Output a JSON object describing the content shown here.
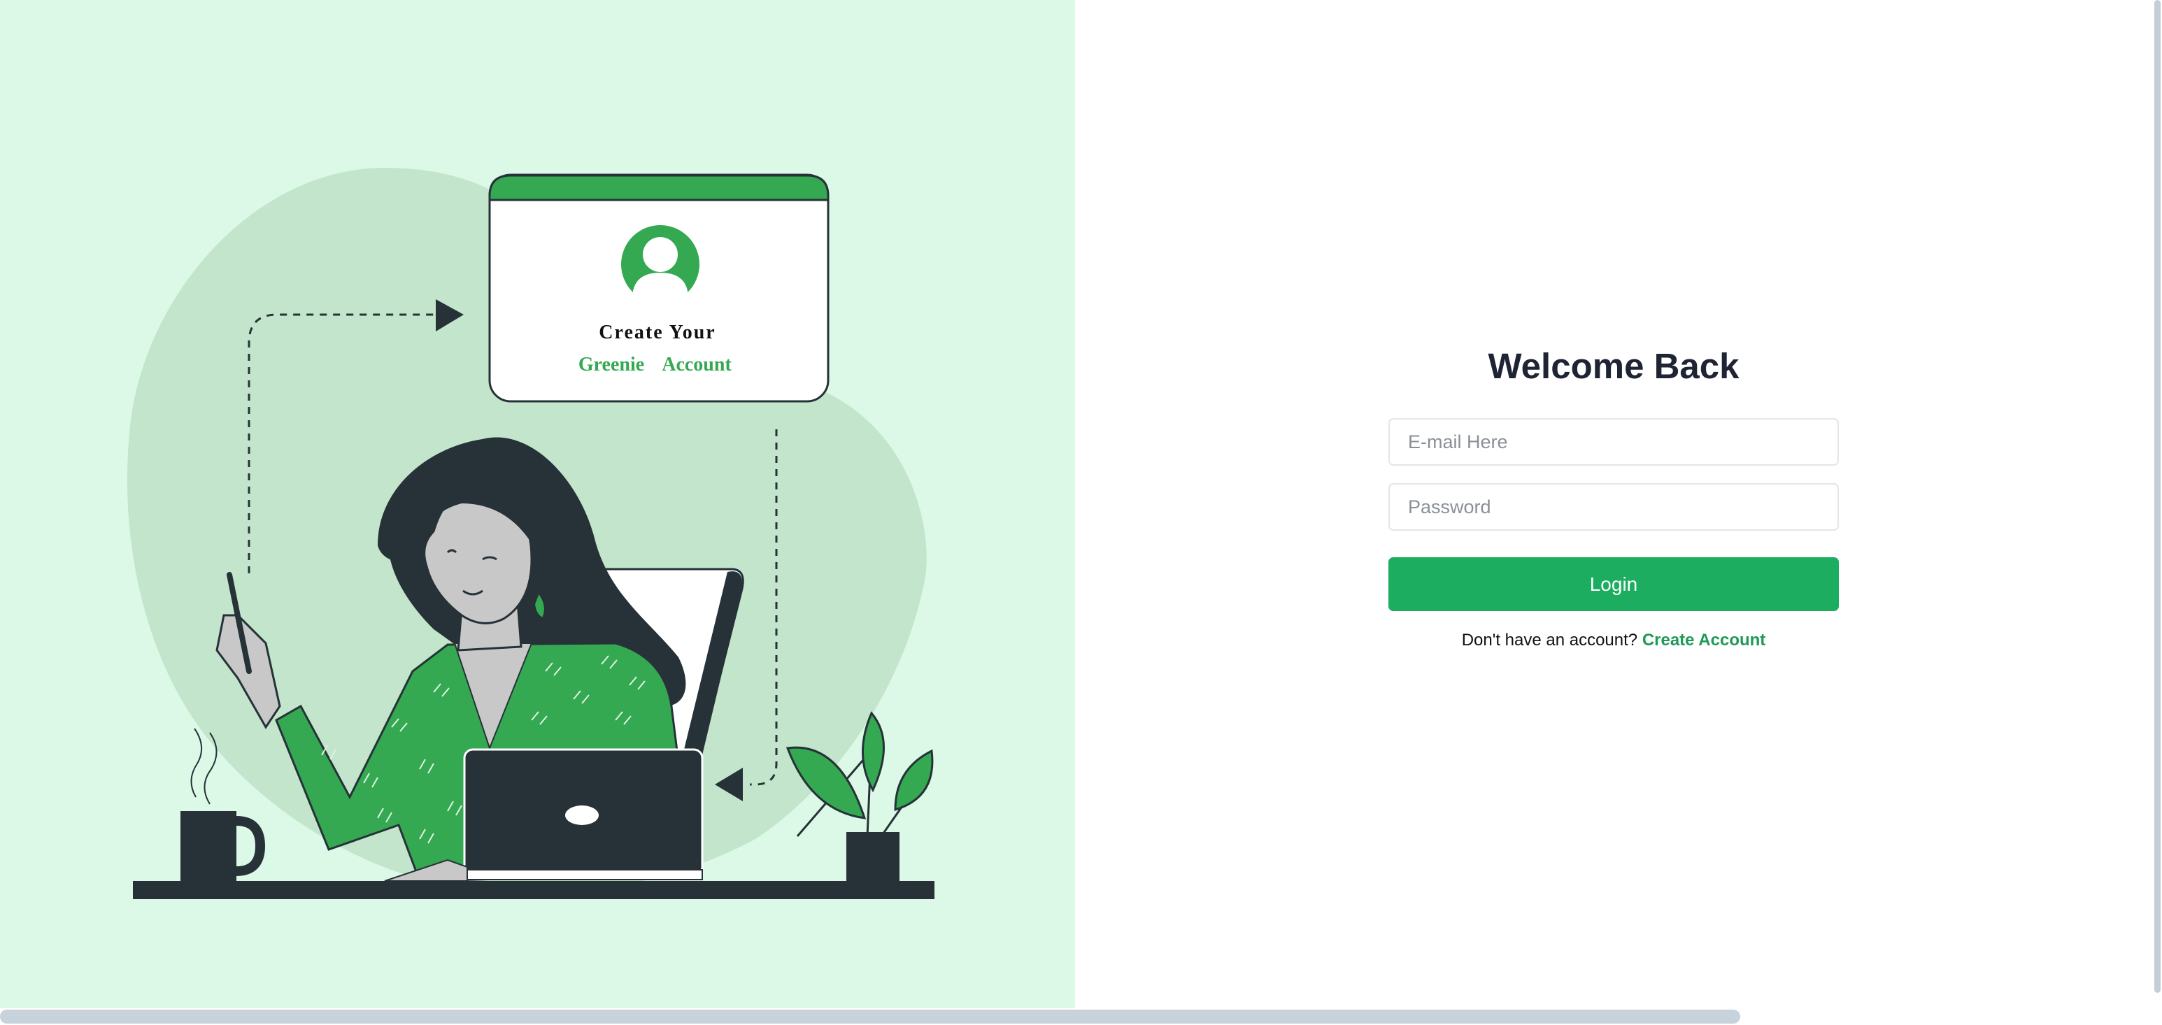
{
  "illustration": {
    "card_line1": "Create Your",
    "card_word1": "Greenie",
    "card_word2": "Account",
    "icons": [
      "user-avatar-icon",
      "arrow-right-icon",
      "arrow-left-icon"
    ]
  },
  "login": {
    "title": "Welcome Back",
    "email_placeholder": "E-mail Here",
    "email_value": "",
    "password_placeholder": "Password",
    "password_value": "",
    "button_label": "Login",
    "prompt_text": "Don't have an account?",
    "create_link": "Create Account"
  },
  "colors": {
    "left_background": "#dcf9e8",
    "blob": "#c2e5cc",
    "brand_green": "#1cad60",
    "illustration_green": "#35a852",
    "dark": "#263238",
    "title_text": "#1e2433"
  }
}
